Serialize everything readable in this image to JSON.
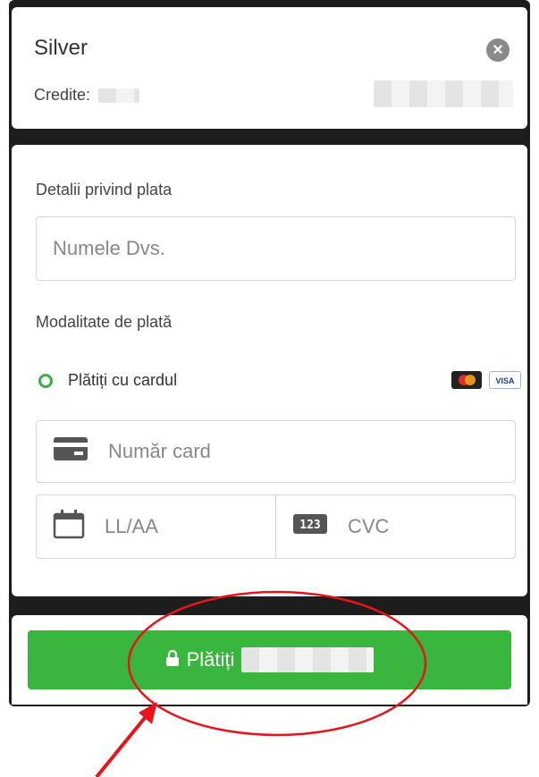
{
  "plan": {
    "name": "Silver",
    "credits_label": "Credite:",
    "close_glyph": "×"
  },
  "payment": {
    "details_label": "Detalii privind plata",
    "name_placeholder": "Numele Dvs.",
    "method_label": "Modalitate de plată",
    "method_option": "Plătiți cu cardul",
    "brands": [
      "mastercard-icon",
      "visa-icon"
    ],
    "visa_text": "VISA",
    "card_number_placeholder": "Număr card",
    "expiry_placeholder": "LL/AA",
    "cvc_placeholder": "CVC",
    "cvc_badge": "123"
  },
  "pay_button": {
    "label": "Plătiți"
  },
  "colors": {
    "accent_green": "#3ab53e",
    "annotation_red": "#e8141b",
    "panel_dark": "#1d1d1d"
  }
}
